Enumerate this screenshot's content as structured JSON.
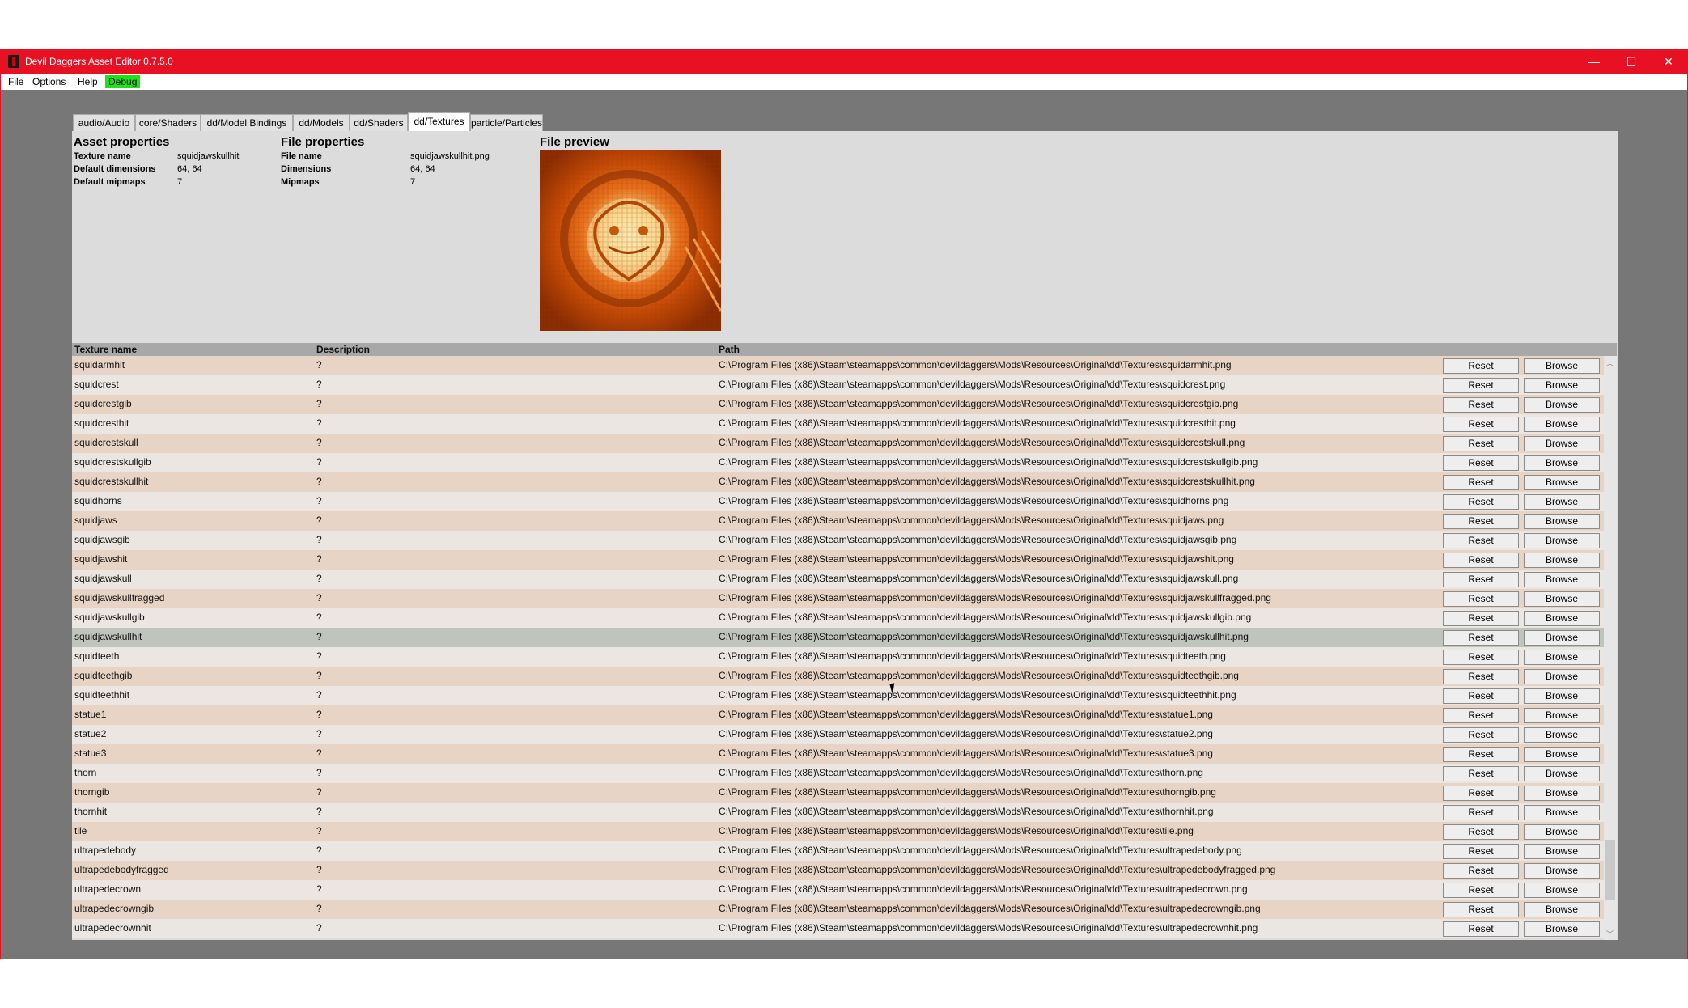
{
  "window": {
    "title": "Devil Daggers Asset Editor 0.7.5.0",
    "minimize_icon": "minimize-icon",
    "maximize_icon": "maximize-icon",
    "close_icon": "close-icon",
    "minimize_glyph": "—",
    "maximize_glyph": "☐",
    "close_glyph": "✕"
  },
  "menu": {
    "file": "File",
    "options": "Options",
    "help": "Help",
    "debug": "Debug"
  },
  "tabs": [
    {
      "label": "audio/Audio"
    },
    {
      "label": "core/Shaders"
    },
    {
      "label": "dd/Model Bindings"
    },
    {
      "label": "dd/Models"
    },
    {
      "label": "dd/Shaders"
    },
    {
      "label": "dd/Textures"
    },
    {
      "label": "particle/Particles"
    }
  ],
  "active_tab": "dd/Textures",
  "asset_properties": {
    "title": "Asset properties",
    "texture_name_label": "Texture name",
    "texture_name": "squidjawskullhit",
    "default_dimensions_label": "Default dimensions",
    "default_dimensions": "64, 64",
    "default_mipmaps_label": "Default mipmaps",
    "default_mipmaps": "7"
  },
  "file_properties": {
    "title": "File properties",
    "file_name_label": "File name",
    "file_name": "squidjawskullhit.png",
    "dimensions_label": "Dimensions",
    "dimensions": "64, 64",
    "mipmaps_label": "Mipmaps",
    "mipmaps": "7"
  },
  "file_preview": {
    "title": "File preview"
  },
  "table": {
    "headers": {
      "name": "Texture name",
      "description": "Description",
      "path": "Path"
    },
    "reset_label": "Reset",
    "browse_label": "Browse",
    "selected": "squidjawskullhit",
    "rows": [
      {
        "name": "squidarmhit",
        "description": "?",
        "path": "C:\\Program Files (x86)\\Steam\\steamapps\\common\\devildaggers\\Mods\\Resources\\Original\\dd\\Textures\\squidarmhit.png"
      },
      {
        "name": "squidcrest",
        "description": "?",
        "path": "C:\\Program Files (x86)\\Steam\\steamapps\\common\\devildaggers\\Mods\\Resources\\Original\\dd\\Textures\\squidcrest.png"
      },
      {
        "name": "squidcrestgib",
        "description": "?",
        "path": "C:\\Program Files (x86)\\Steam\\steamapps\\common\\devildaggers\\Mods\\Resources\\Original\\dd\\Textures\\squidcrestgib.png"
      },
      {
        "name": "squidcresthit",
        "description": "?",
        "path": "C:\\Program Files (x86)\\Steam\\steamapps\\common\\devildaggers\\Mods\\Resources\\Original\\dd\\Textures\\squidcresthit.png"
      },
      {
        "name": "squidcrestskull",
        "description": "?",
        "path": "C:\\Program Files (x86)\\Steam\\steamapps\\common\\devildaggers\\Mods\\Resources\\Original\\dd\\Textures\\squidcrestskull.png"
      },
      {
        "name": "squidcrestskullgib",
        "description": "?",
        "path": "C:\\Program Files (x86)\\Steam\\steamapps\\common\\devildaggers\\Mods\\Resources\\Original\\dd\\Textures\\squidcrestskullgib.png"
      },
      {
        "name": "squidcrestskullhit",
        "description": "?",
        "path": "C:\\Program Files (x86)\\Steam\\steamapps\\common\\devildaggers\\Mods\\Resources\\Original\\dd\\Textures\\squidcrestskullhit.png"
      },
      {
        "name": "squidhorns",
        "description": "?",
        "path": "C:\\Program Files (x86)\\Steam\\steamapps\\common\\devildaggers\\Mods\\Resources\\Original\\dd\\Textures\\squidhorns.png"
      },
      {
        "name": "squidjaws",
        "description": "?",
        "path": "C:\\Program Files (x86)\\Steam\\steamapps\\common\\devildaggers\\Mods\\Resources\\Original\\dd\\Textures\\squidjaws.png"
      },
      {
        "name": "squidjawsgib",
        "description": "?",
        "path": "C:\\Program Files (x86)\\Steam\\steamapps\\common\\devildaggers\\Mods\\Resources\\Original\\dd\\Textures\\squidjawsgib.png"
      },
      {
        "name": "squidjawshit",
        "description": "?",
        "path": "C:\\Program Files (x86)\\Steam\\steamapps\\common\\devildaggers\\Mods\\Resources\\Original\\dd\\Textures\\squidjawshit.png"
      },
      {
        "name": "squidjawskull",
        "description": "?",
        "path": "C:\\Program Files (x86)\\Steam\\steamapps\\common\\devildaggers\\Mods\\Resources\\Original\\dd\\Textures\\squidjawskull.png"
      },
      {
        "name": "squidjawskullfragged",
        "description": "?",
        "path": "C:\\Program Files (x86)\\Steam\\steamapps\\common\\devildaggers\\Mods\\Resources\\Original\\dd\\Textures\\squidjawskullfragged.png"
      },
      {
        "name": "squidjawskullgib",
        "description": "?",
        "path": "C:\\Program Files (x86)\\Steam\\steamapps\\common\\devildaggers\\Mods\\Resources\\Original\\dd\\Textures\\squidjawskullgib.png"
      },
      {
        "name": "squidjawskullhit",
        "description": "?",
        "path": "C:\\Program Files (x86)\\Steam\\steamapps\\common\\devildaggers\\Mods\\Resources\\Original\\dd\\Textures\\squidjawskullhit.png"
      },
      {
        "name": "squidteeth",
        "description": "?",
        "path": "C:\\Program Files (x86)\\Steam\\steamapps\\common\\devildaggers\\Mods\\Resources\\Original\\dd\\Textures\\squidteeth.png"
      },
      {
        "name": "squidteethgib",
        "description": "?",
        "path": "C:\\Program Files (x86)\\Steam\\steamapps\\common\\devildaggers\\Mods\\Resources\\Original\\dd\\Textures\\squidteethgib.png"
      },
      {
        "name": "squidteethhit",
        "description": "?",
        "path": "C:\\Program Files (x86)\\Steam\\steamapps\\common\\devildaggers\\Mods\\Resources\\Original\\dd\\Textures\\squidteethhit.png"
      },
      {
        "name": "statue1",
        "description": "?",
        "path": "C:\\Program Files (x86)\\Steam\\steamapps\\common\\devildaggers\\Mods\\Resources\\Original\\dd\\Textures\\statue1.png"
      },
      {
        "name": "statue2",
        "description": "?",
        "path": "C:\\Program Files (x86)\\Steam\\steamapps\\common\\devildaggers\\Mods\\Resources\\Original\\dd\\Textures\\statue2.png"
      },
      {
        "name": "statue3",
        "description": "?",
        "path": "C:\\Program Files (x86)\\Steam\\steamapps\\common\\devildaggers\\Mods\\Resources\\Original\\dd\\Textures\\statue3.png"
      },
      {
        "name": "thorn",
        "description": "?",
        "path": "C:\\Program Files (x86)\\Steam\\steamapps\\common\\devildaggers\\Mods\\Resources\\Original\\dd\\Textures\\thorn.png"
      },
      {
        "name": "thorngib",
        "description": "?",
        "path": "C:\\Program Files (x86)\\Steam\\steamapps\\common\\devildaggers\\Mods\\Resources\\Original\\dd\\Textures\\thorngib.png"
      },
      {
        "name": "thornhit",
        "description": "?",
        "path": "C:\\Program Files (x86)\\Steam\\steamapps\\common\\devildaggers\\Mods\\Resources\\Original\\dd\\Textures\\thornhit.png"
      },
      {
        "name": "tile",
        "description": "?",
        "path": "C:\\Program Files (x86)\\Steam\\steamapps\\common\\devildaggers\\Mods\\Resources\\Original\\dd\\Textures\\tile.png"
      },
      {
        "name": "ultrapedebody",
        "description": "?",
        "path": "C:\\Program Files (x86)\\Steam\\steamapps\\common\\devildaggers\\Mods\\Resources\\Original\\dd\\Textures\\ultrapedebody.png"
      },
      {
        "name": "ultrapedebodyfragged",
        "description": "?",
        "path": "C:\\Program Files (x86)\\Steam\\steamapps\\common\\devildaggers\\Mods\\Resources\\Original\\dd\\Textures\\ultrapedebodyfragged.png"
      },
      {
        "name": "ultrapedecrown",
        "description": "?",
        "path": "C:\\Program Files (x86)\\Steam\\steamapps\\common\\devildaggers\\Mods\\Resources\\Original\\dd\\Textures\\ultrapedecrown.png"
      },
      {
        "name": "ultrapedecrowngib",
        "description": "?",
        "path": "C:\\Program Files (x86)\\Steam\\steamapps\\common\\devildaggers\\Mods\\Resources\\Original\\dd\\Textures\\ultrapedecrowngib.png"
      },
      {
        "name": "ultrapedecrownhit",
        "description": "?",
        "path": "C:\\Program Files (x86)\\Steam\\steamapps\\common\\devildaggers\\Mods\\Resources\\Original\\dd\\Textures\\ultrapedecrownhit.png"
      }
    ]
  },
  "colors": {
    "title_bar": "#e81123",
    "debug_badge": "#19e619",
    "row_odd": "#e8d4c4",
    "row_even": "#ebe6e2",
    "row_selected": "#bfc4bc"
  }
}
